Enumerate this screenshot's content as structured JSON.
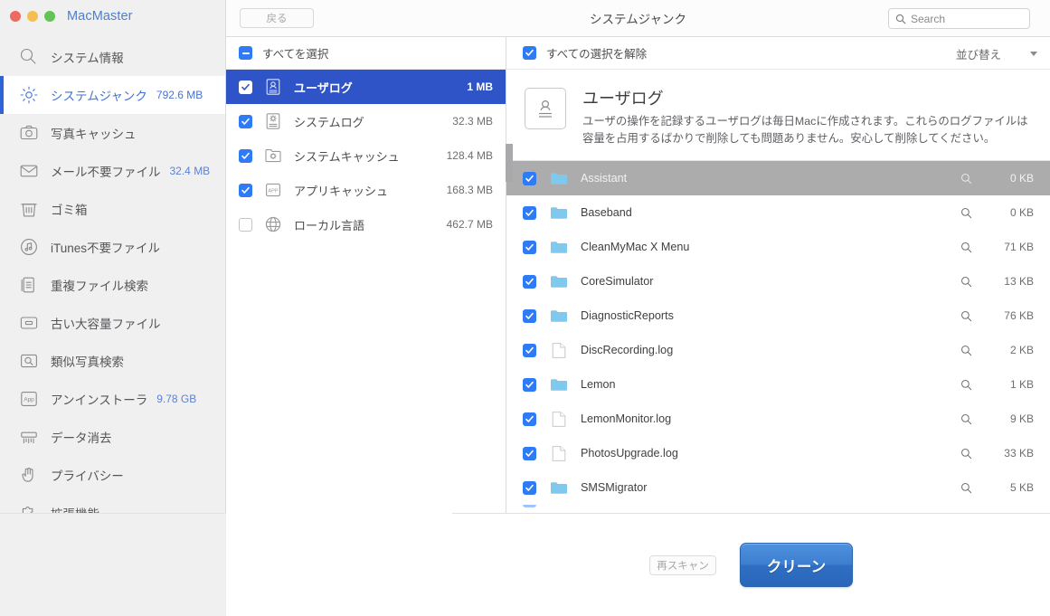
{
  "window": {
    "title": "MacMaster",
    "traffic_lights": [
      "close-red",
      "minimize-yellow",
      "maximize-green"
    ]
  },
  "sidebar": {
    "items": [
      {
        "label": "システム情報",
        "size": "",
        "icon": "magnifier-icon",
        "active": false
      },
      {
        "label": "システムジャンク",
        "size": "792.6 MB",
        "icon": "gear-icon",
        "active": true
      },
      {
        "label": "写真キャッシュ",
        "size": "",
        "icon": "camera-icon",
        "active": false
      },
      {
        "label": "メール不要ファイル",
        "size": "32.4 MB",
        "icon": "mail-icon",
        "active": false
      },
      {
        "label": "ゴミ箱",
        "size": "",
        "icon": "trash-icon",
        "active": false
      },
      {
        "label": "iTunes不要ファイル",
        "size": "",
        "icon": "music-note-icon",
        "active": false
      },
      {
        "label": "重複ファイル検索",
        "size": "",
        "icon": "documents-icon",
        "active": false
      },
      {
        "label": "古い大容量ファイル",
        "size": "",
        "icon": "drawer-icon",
        "active": false
      },
      {
        "label": "類似写真検索",
        "size": "",
        "icon": "photo-search-icon",
        "active": false
      },
      {
        "label": "アンインストーラ",
        "size": "9.78 GB",
        "icon": "app-box-icon",
        "active": false
      },
      {
        "label": "データ消去",
        "size": "",
        "icon": "shredder-icon",
        "active": false
      },
      {
        "label": "プライバシー",
        "size": "",
        "icon": "hand-icon",
        "active": false
      },
      {
        "label": "拡張機能",
        "size": "",
        "icon": "puzzle-icon",
        "active": false
      }
    ]
  },
  "topbar": {
    "back_label": "戻る",
    "title": "システムジャンク",
    "search_placeholder": "Search",
    "search_value": ""
  },
  "middle": {
    "select_all_label": "すべてを選択",
    "select_all_state": "mixed",
    "categories": [
      {
        "name": "ユーザログ",
        "size": "1 MB",
        "checked": true,
        "selected": true,
        "icon": "user-log-icon"
      },
      {
        "name": "システムログ",
        "size": "32.3 MB",
        "checked": true,
        "selected": false,
        "icon": "system-log-icon"
      },
      {
        "name": "システムキャッシュ",
        "size": "128.4 MB",
        "checked": true,
        "selected": false,
        "icon": "system-cache-icon"
      },
      {
        "name": "アプリキャッシュ",
        "size": "168.3 MB",
        "checked": true,
        "selected": false,
        "icon": "app-cache-icon"
      },
      {
        "name": "ローカル言語",
        "size": "462.7 MB",
        "checked": false,
        "selected": false,
        "icon": "globe-icon"
      }
    ]
  },
  "detail": {
    "deselect_all_label": "すべての選択を解除",
    "deselect_all_state": "on",
    "sort_label": "並び替え",
    "header_icon": "user-log-icon",
    "header_title": "ユーザログ",
    "header_desc": "ユーザの操作を記録するユーザログは毎日Macに作成されます。これらのログファイルは容量を占用するばかりで削除しても問題ありません。安心して削除してください。",
    "files": [
      {
        "name": "Assistant",
        "size": "0 KB",
        "type": "folder",
        "checked": true,
        "highlighted": true
      },
      {
        "name": "Baseband",
        "size": "0 KB",
        "type": "folder",
        "checked": true,
        "highlighted": false
      },
      {
        "name": "CleanMyMac X Menu",
        "size": "71 KB",
        "type": "folder",
        "checked": true,
        "highlighted": false
      },
      {
        "name": "CoreSimulator",
        "size": "13 KB",
        "type": "folder",
        "checked": true,
        "highlighted": false
      },
      {
        "name": "DiagnosticReports",
        "size": "76 KB",
        "type": "folder",
        "checked": true,
        "highlighted": false
      },
      {
        "name": "DiscRecording.log",
        "size": "2 KB",
        "type": "file",
        "checked": true,
        "highlighted": false
      },
      {
        "name": "Lemon",
        "size": "1 KB",
        "type": "folder",
        "checked": true,
        "highlighted": false
      },
      {
        "name": "LemonMonitor.log",
        "size": "9 KB",
        "type": "file",
        "checked": true,
        "highlighted": false
      },
      {
        "name": "PhotosUpgrade.log",
        "size": "33 KB",
        "type": "file",
        "checked": true,
        "highlighted": false
      },
      {
        "name": "SMSMigrator",
        "size": "5 KB",
        "type": "folder",
        "checked": true,
        "highlighted": false
      }
    ],
    "reveal_icon": "magnifier-icon"
  },
  "footer": {
    "rescan_label": "再スキャン",
    "clean_label": "クリーン"
  },
  "colors": {
    "accent_blue": "#2f54c8",
    "checkbox_blue": "#2f7bf6",
    "link_blue": "#5b82d6",
    "clean_button": "#3d7fd0",
    "row_highlight": "#acacac",
    "folder_blue": "#7fc8ee"
  }
}
